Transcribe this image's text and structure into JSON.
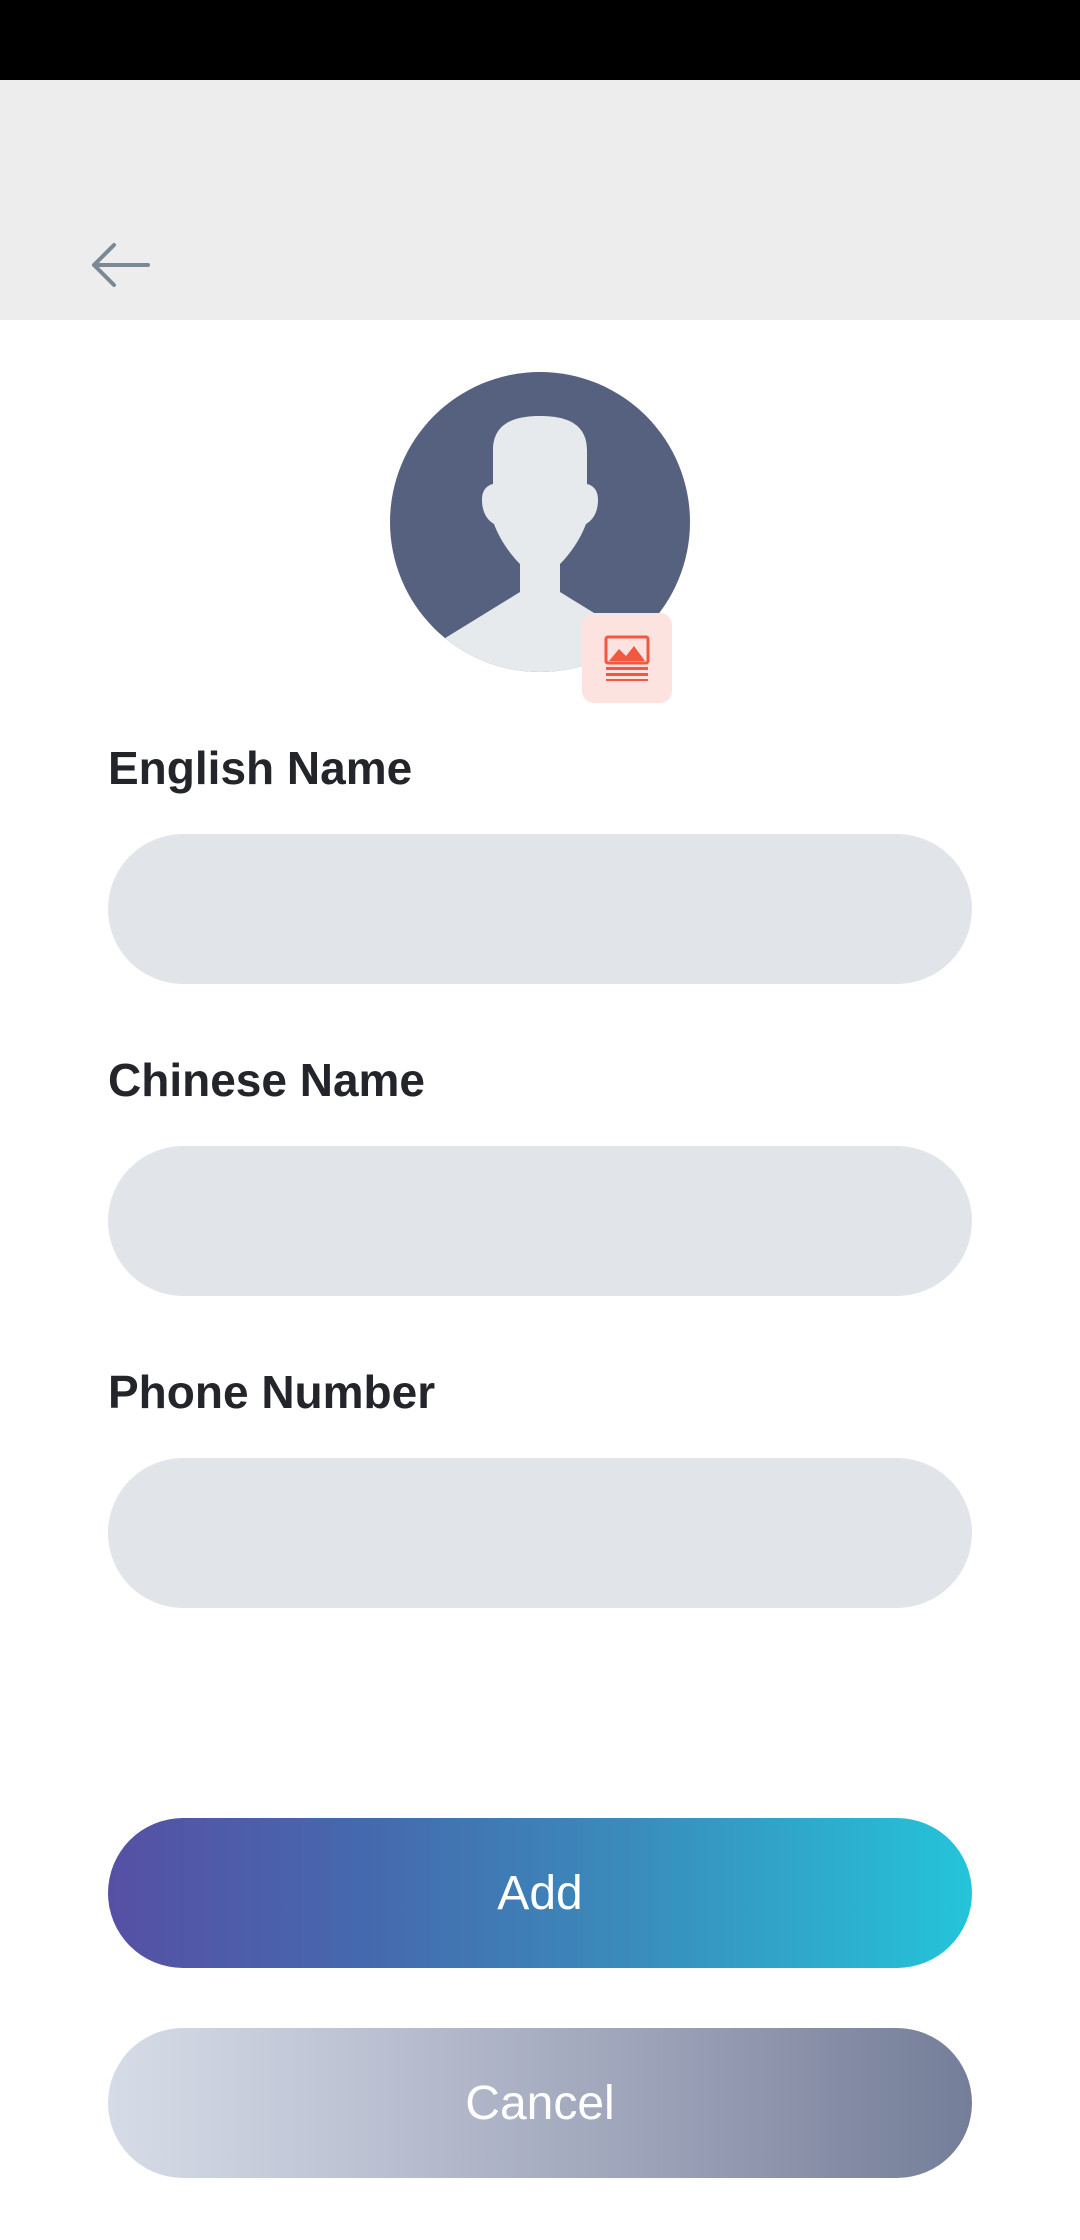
{
  "header": {
    "back_icon": "arrow-left-icon",
    "back_icon_color": "#7b8895"
  },
  "avatar": {
    "icon": "user-silhouette-icon",
    "bg_color": "#56617f",
    "figure_color": "#e6eaed",
    "photo_button_icon": "image-picker-icon",
    "photo_button_color": "#f0583f"
  },
  "form": {
    "english_name": {
      "label": "English Name",
      "value": "",
      "placeholder": ""
    },
    "chinese_name": {
      "label": "Chinese Name",
      "value": "",
      "placeholder": ""
    },
    "phone_number": {
      "label": "Phone Number",
      "value": "",
      "placeholder": ""
    }
  },
  "actions": {
    "add_label": "Add",
    "cancel_label": "Cancel"
  }
}
